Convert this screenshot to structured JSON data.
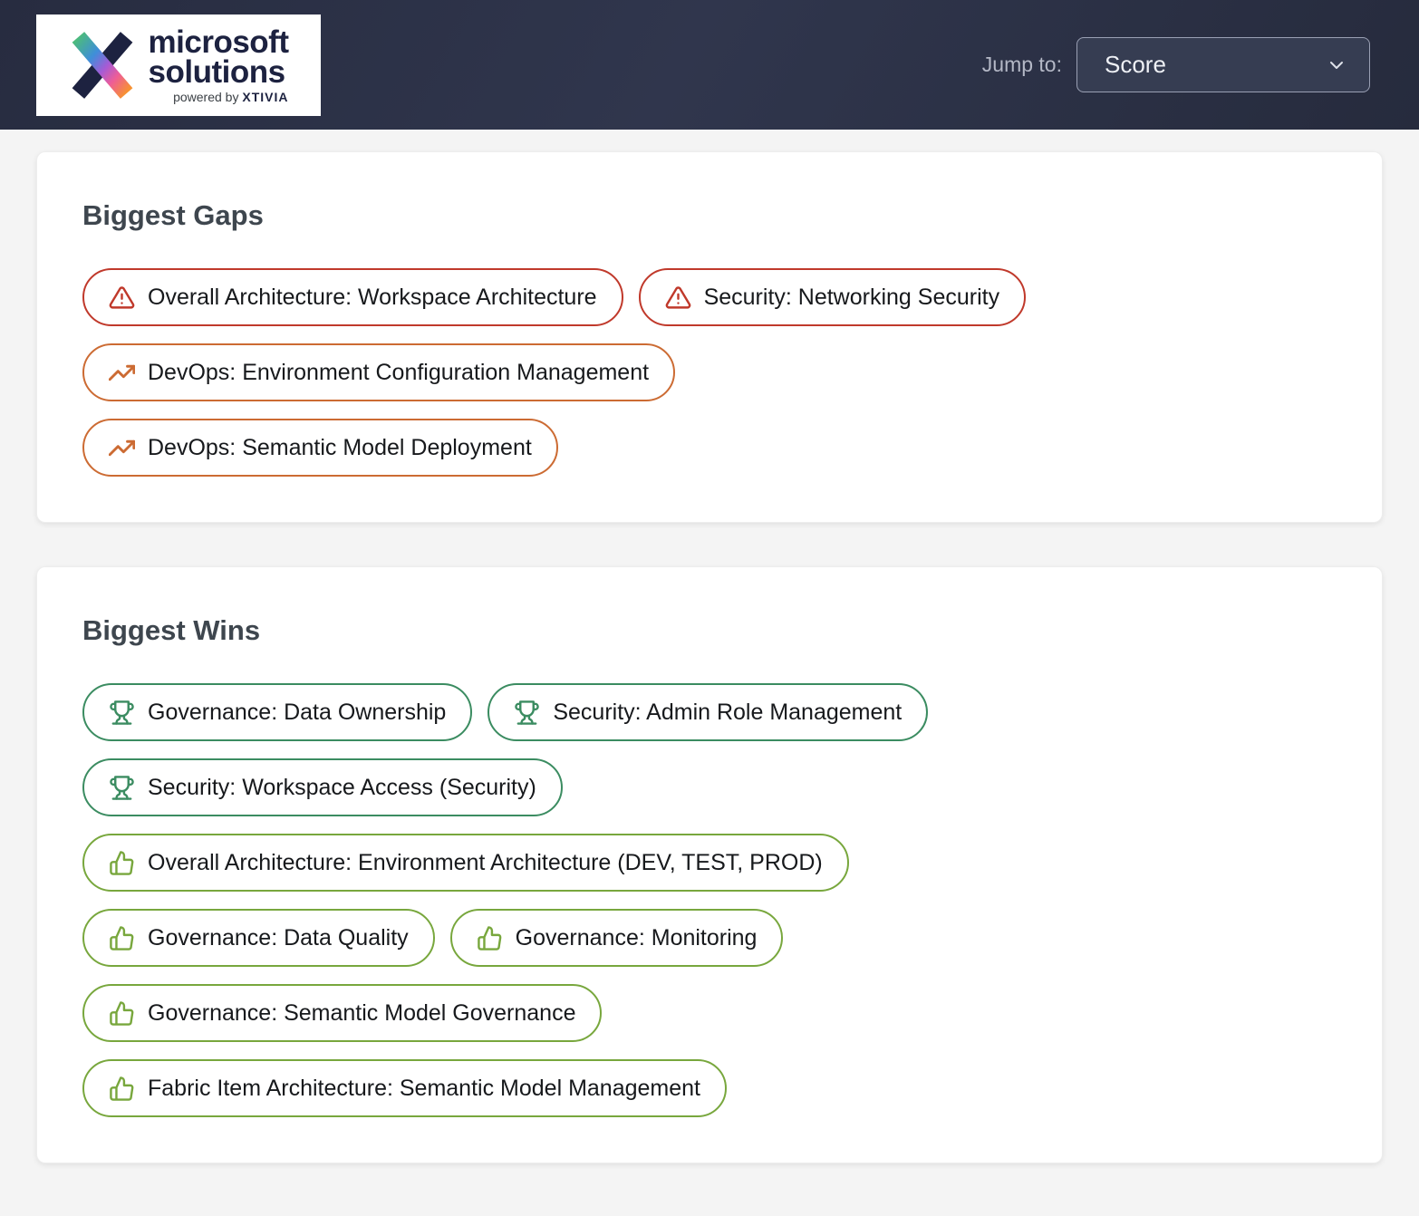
{
  "header": {
    "logo": {
      "line1": "microsoft",
      "line2": "solutions",
      "powered_by": "powered by",
      "brand": "XTIVIA"
    },
    "jump_to_label": "Jump to:",
    "jump_to_value": "Score"
  },
  "gaps": {
    "title": "Biggest Gaps",
    "rows": [
      [
        {
          "icon": "alert-triangle",
          "level": "gap_critical",
          "label": "Overall Architecture: Workspace Architecture"
        },
        {
          "icon": "alert-triangle",
          "level": "gap_critical",
          "label": "Security: Networking Security"
        }
      ],
      [
        {
          "icon": "trending-up",
          "level": "gap_moderate",
          "label": "DevOps: Environment Configuration Management"
        }
      ],
      [
        {
          "icon": "trending-up",
          "level": "gap_moderate",
          "label": "DevOps: Semantic Model Deployment"
        }
      ]
    ]
  },
  "wins": {
    "title": "Biggest Wins",
    "rows": [
      [
        {
          "icon": "trophy",
          "level": "win_top",
          "label": "Governance: Data Ownership"
        },
        {
          "icon": "trophy",
          "level": "win_top",
          "label": "Security: Admin Role Management"
        }
      ],
      [
        {
          "icon": "trophy",
          "level": "win_top",
          "label": "Security: Workspace Access (Security)"
        }
      ],
      [
        {
          "icon": "thumbs-up",
          "level": "win_good",
          "label": "Overall Architecture: Environment Architecture (DEV, TEST, PROD)"
        }
      ],
      [
        {
          "icon": "thumbs-up",
          "level": "win_good",
          "label": "Governance: Data Quality"
        },
        {
          "icon": "thumbs-up",
          "level": "win_good",
          "label": "Governance: Monitoring"
        }
      ],
      [
        {
          "icon": "thumbs-up",
          "level": "win_good",
          "label": "Governance: Semantic Model Governance"
        }
      ],
      [
        {
          "icon": "thumbs-up",
          "level": "win_good",
          "label": "Fabric Item Architecture: Semantic Model Management"
        }
      ]
    ]
  },
  "colors": {
    "gap_critical": "#c0392b",
    "gap_moderate": "#cc6b33",
    "win_top": "#3b8c61",
    "win_good": "#78a73d",
    "header_bg": "#2b3045",
    "logo_navy": "#1d2240"
  }
}
